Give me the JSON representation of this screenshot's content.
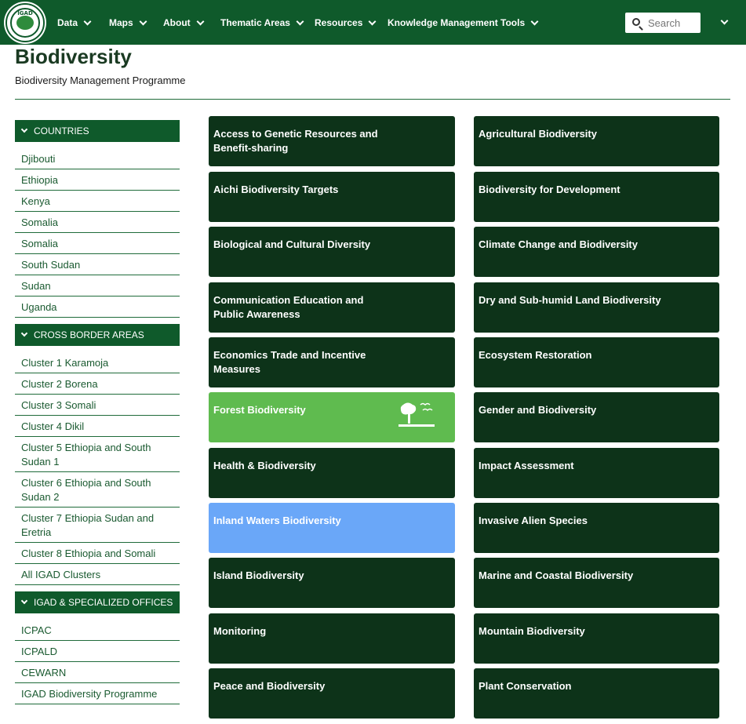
{
  "nav": {
    "logo_text": "IGAD",
    "items": [
      "Data",
      "Maps",
      "About",
      "Thematic Areas",
      "Resources",
      "Knowledge Management Tools"
    ],
    "search_placeholder": "Search"
  },
  "header": {
    "title": "Biodiversity",
    "subtitle": "Biodiversity Management Programme"
  },
  "sidebar": {
    "sections": [
      {
        "title": "COUNTRIES",
        "items": [
          "Djibouti",
          "Ethiopia",
          "Kenya",
          "Somalia",
          "Somalia",
          "South Sudan",
          "Sudan",
          "Uganda"
        ]
      },
      {
        "title": "CROSS BORDER AREAS",
        "items": [
          "Cluster 1 Karamoja",
          "Cluster 2 Borena",
          "Cluster 3 Somali",
          "Cluster 4 Dikil",
          "Cluster 5 Ethiopia and South Sudan 1",
          "Cluster 6 Ethiopia and South Sudan 2",
          "Cluster 7 Ethiopia Sudan and Eretria",
          "Cluster 8 Ethiopia and Somali",
          "All IGAD Clusters"
        ]
      },
      {
        "title": "IGAD & SPECIALIZED OFFICES",
        "items": [
          "ICPAC",
          "ICPALD",
          "CEWARN",
          "IGAD Biodiversity Programme"
        ]
      }
    ]
  },
  "tiles": {
    "left": [
      "Access to Genetic Resources and Benefit-sharing",
      "Aichi Biodiversity Targets",
      "Biological and Cultural Diversity",
      "Communication Education and Public Awareness",
      "Economics Trade and Incentive Measures",
      "Forest Biodiversity",
      "Health & Biodiversity",
      "Inland Waters Biodiversity",
      "Island Biodiversity",
      "Monitoring",
      "Peace and Biodiversity"
    ],
    "right": [
      "Agricultural Biodiversity",
      "Biodiversity for Development",
      "Climate Change and Biodiversity",
      "Dry and Sub-humid Land Biodiversity",
      "Ecosystem Restoration",
      "Gender and Biodiversity",
      "Impact Assessment",
      "Invasive Alien Species",
      "Marine and Coastal Biodiversity",
      "Mountain Biodiversity",
      "Plant Conservation"
    ],
    "highlighted": {
      "Forest Biodiversity": "green",
      "Inland Waters Biodiversity": "blue"
    },
    "icons": {
      "Forest Biodiversity": "tree-icon"
    }
  },
  "colors": {
    "nav_bg": "#0f5a2b",
    "tile_bg": "#0d3319",
    "tile_green": "#5fbb4f",
    "tile_blue": "#6aa7f8"
  }
}
